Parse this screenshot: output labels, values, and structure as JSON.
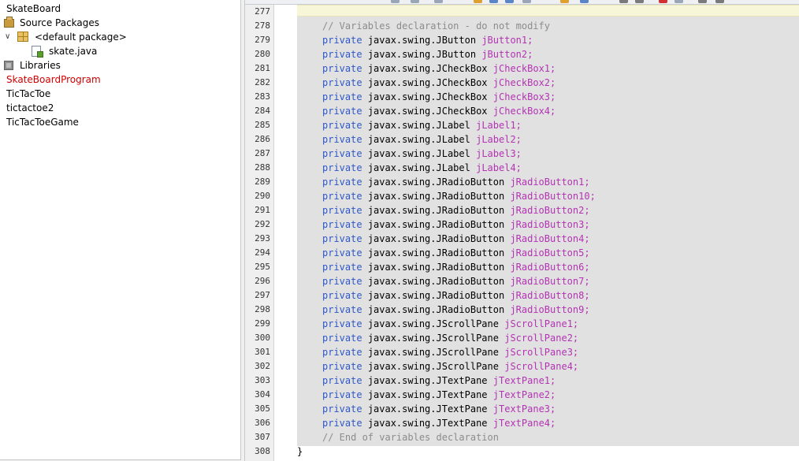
{
  "projects_tree": {
    "items": [
      {
        "label": "SkateBoard",
        "level": 0,
        "icon": "none"
      },
      {
        "label": "Source Packages",
        "level": 0,
        "icon": "source-packages-icon"
      },
      {
        "label": "<default package>",
        "level": 1,
        "icon": "package-icon",
        "expanded": true
      },
      {
        "label": "skate.java",
        "level": 2,
        "icon": "java-file-icon"
      },
      {
        "label": "Libraries",
        "level": 0,
        "icon": "libraries-icon"
      },
      {
        "label": "SkateBoardProgram",
        "level": 0,
        "icon": "none",
        "color": "#d20000"
      },
      {
        "label": "TicTacToe",
        "level": 0,
        "icon": "none"
      },
      {
        "label": "tictactoe2",
        "level": 0,
        "icon": "none"
      },
      {
        "label": "TicTacToeGame",
        "level": 0,
        "icon": "none"
      }
    ]
  },
  "editor": {
    "colors": {
      "keyword": "#2e57c9",
      "field": "#b333b3",
      "comment": "#8c8c8c",
      "selection": "#e1e1e1",
      "current_line": "#f7f6d8"
    },
    "lines": [
      {
        "num": "277",
        "kind": "blank"
      },
      {
        "num": "278",
        "kind": "comment",
        "text": "// Variables declaration - do not modify"
      },
      {
        "num": "279",
        "kind": "decl",
        "kw": "private",
        "type": "javax.swing.JButton",
        "name": "jButton1;"
      },
      {
        "num": "280",
        "kind": "decl",
        "kw": "private",
        "type": "javax.swing.JButton",
        "name": "jButton2;"
      },
      {
        "num": "281",
        "kind": "decl",
        "kw": "private",
        "type": "javax.swing.JCheckBox",
        "name": "jCheckBox1;"
      },
      {
        "num": "282",
        "kind": "decl",
        "kw": "private",
        "type": "javax.swing.JCheckBox",
        "name": "jCheckBox2;"
      },
      {
        "num": "283",
        "kind": "decl",
        "kw": "private",
        "type": "javax.swing.JCheckBox",
        "name": "jCheckBox3;"
      },
      {
        "num": "284",
        "kind": "decl",
        "kw": "private",
        "type": "javax.swing.JCheckBox",
        "name": "jCheckBox4;"
      },
      {
        "num": "285",
        "kind": "decl",
        "kw": "private",
        "type": "javax.swing.JLabel",
        "name": "jLabel1;"
      },
      {
        "num": "286",
        "kind": "decl",
        "kw": "private",
        "type": "javax.swing.JLabel",
        "name": "jLabel2;"
      },
      {
        "num": "287",
        "kind": "decl",
        "kw": "private",
        "type": "javax.swing.JLabel",
        "name": "jLabel3;"
      },
      {
        "num": "288",
        "kind": "decl",
        "kw": "private",
        "type": "javax.swing.JLabel",
        "name": "jLabel4;"
      },
      {
        "num": "289",
        "kind": "decl",
        "kw": "private",
        "type": "javax.swing.JRadioButton",
        "name": "jRadioButton1;"
      },
      {
        "num": "290",
        "kind": "decl",
        "kw": "private",
        "type": "javax.swing.JRadioButton",
        "name": "jRadioButton10;"
      },
      {
        "num": "291",
        "kind": "decl",
        "kw": "private",
        "type": "javax.swing.JRadioButton",
        "name": "jRadioButton2;"
      },
      {
        "num": "292",
        "kind": "decl",
        "kw": "private",
        "type": "javax.swing.JRadioButton",
        "name": "jRadioButton3;"
      },
      {
        "num": "293",
        "kind": "decl",
        "kw": "private",
        "type": "javax.swing.JRadioButton",
        "name": "jRadioButton4;"
      },
      {
        "num": "294",
        "kind": "decl",
        "kw": "private",
        "type": "javax.swing.JRadioButton",
        "name": "jRadioButton5;"
      },
      {
        "num": "295",
        "kind": "decl",
        "kw": "private",
        "type": "javax.swing.JRadioButton",
        "name": "jRadioButton6;"
      },
      {
        "num": "296",
        "kind": "decl",
        "kw": "private",
        "type": "javax.swing.JRadioButton",
        "name": "jRadioButton7;"
      },
      {
        "num": "297",
        "kind": "decl",
        "kw": "private",
        "type": "javax.swing.JRadioButton",
        "name": "jRadioButton8;"
      },
      {
        "num": "298",
        "kind": "decl",
        "kw": "private",
        "type": "javax.swing.JRadioButton",
        "name": "jRadioButton9;"
      },
      {
        "num": "299",
        "kind": "decl",
        "kw": "private",
        "type": "javax.swing.JScrollPane",
        "name": "jScrollPane1;"
      },
      {
        "num": "300",
        "kind": "decl",
        "kw": "private",
        "type": "javax.swing.JScrollPane",
        "name": "jScrollPane2;"
      },
      {
        "num": "301",
        "kind": "decl",
        "kw": "private",
        "type": "javax.swing.JScrollPane",
        "name": "jScrollPane3;"
      },
      {
        "num": "302",
        "kind": "decl",
        "kw": "private",
        "type": "javax.swing.JScrollPane",
        "name": "jScrollPane4;"
      },
      {
        "num": "303",
        "kind": "decl",
        "kw": "private",
        "type": "javax.swing.JTextPane",
        "name": "jTextPane1;"
      },
      {
        "num": "304",
        "kind": "decl",
        "kw": "private",
        "type": "javax.swing.JTextPane",
        "name": "jTextPane2;"
      },
      {
        "num": "305",
        "kind": "decl",
        "kw": "private",
        "type": "javax.swing.JTextPane",
        "name": "jTextPane3;"
      },
      {
        "num": "306",
        "kind": "decl",
        "kw": "private",
        "type": "javax.swing.JTextPane",
        "name": "jTextPane4;"
      },
      {
        "num": "307",
        "kind": "comment",
        "text": "// End of variables declaration"
      },
      {
        "num": "308",
        "kind": "brace",
        "text": "}"
      }
    ]
  }
}
